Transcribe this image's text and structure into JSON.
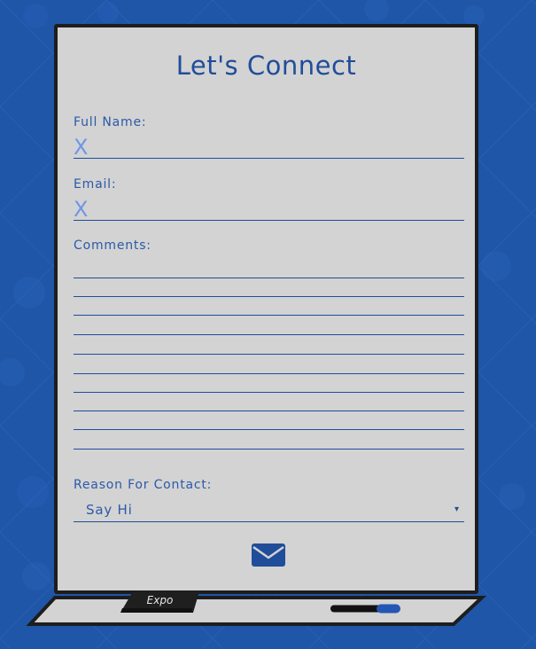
{
  "form": {
    "title": "Let's Connect",
    "full_name_label": "Full Name:",
    "full_name_mark": "X",
    "email_label": "Email:",
    "email_mark": "X",
    "comments_label": "Comments:",
    "reason_label": "Reason For Contact:",
    "reason_selected": "Say Hi",
    "reason_arrow": "▾",
    "send_icon": "envelope-icon"
  },
  "ledge": {
    "eraser_label": "Expo"
  },
  "colors": {
    "background": "#1f56a8",
    "board": "#d3d3d3",
    "ink": "#1f4d9a",
    "frame": "#1d1d1d",
    "marker_cap": "#2457b3"
  }
}
